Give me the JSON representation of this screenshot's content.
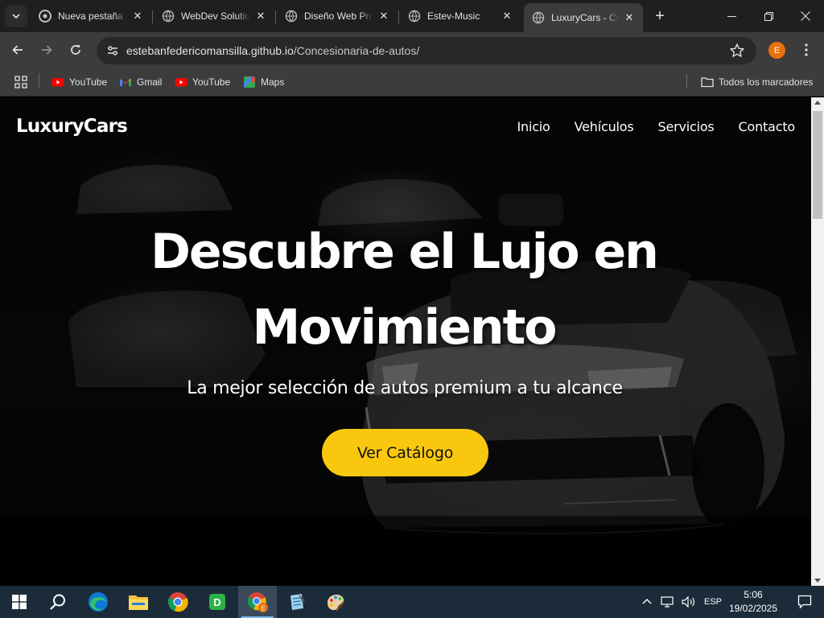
{
  "browser": {
    "tabs": [
      {
        "title": "Nueva pestaña",
        "icon": "chrome-icon",
        "active": false
      },
      {
        "title": "WebDev Solutions",
        "icon": "globe-icon",
        "active": false
      },
      {
        "title": "Diseño Web Pro",
        "icon": "globe-icon",
        "active": false
      },
      {
        "title": "Estev-Music",
        "icon": "globe-icon",
        "active": false
      },
      {
        "title": "LuxuryCars - Concesionaria",
        "icon": "globe-icon",
        "active": true
      }
    ],
    "address": {
      "domain": "estebanfedericomansilla.github.io",
      "path": "/Concesionaria-de-autos/"
    },
    "profile_initial": "E",
    "bookmarks": [
      {
        "label": "YouTube",
        "icon": "youtube-icon"
      },
      {
        "label": "Gmail",
        "icon": "gmail-icon"
      },
      {
        "label": "YouTube",
        "icon": "youtube-icon"
      },
      {
        "label": "Maps",
        "icon": "maps-icon"
      }
    ],
    "all_bookmarks_label": "Todos los marcadores"
  },
  "site": {
    "logo": "LuxuryCars",
    "nav": [
      "Inicio",
      "Vehículos",
      "Servicios",
      "Contacto"
    ],
    "hero": {
      "title_line1": "Descubre el Lujo en",
      "title_line2": "Movimiento",
      "subtitle": "La mejor selección de autos premium a tu alcance",
      "cta": "Ver Catálogo"
    },
    "colors": {
      "accent": "#f9c80e",
      "background": "#000000",
      "text": "#ffffff"
    }
  },
  "taskbar": {
    "apps": [
      "windows-start-icon",
      "search-icon",
      "edge-icon",
      "file-explorer-icon",
      "chrome-icon",
      "dbeaver-icon",
      "chrome-profile-icon",
      "notepad-icon",
      "paint-icon"
    ],
    "language": "ESP",
    "time": "5:06",
    "date": "19/02/2025"
  }
}
